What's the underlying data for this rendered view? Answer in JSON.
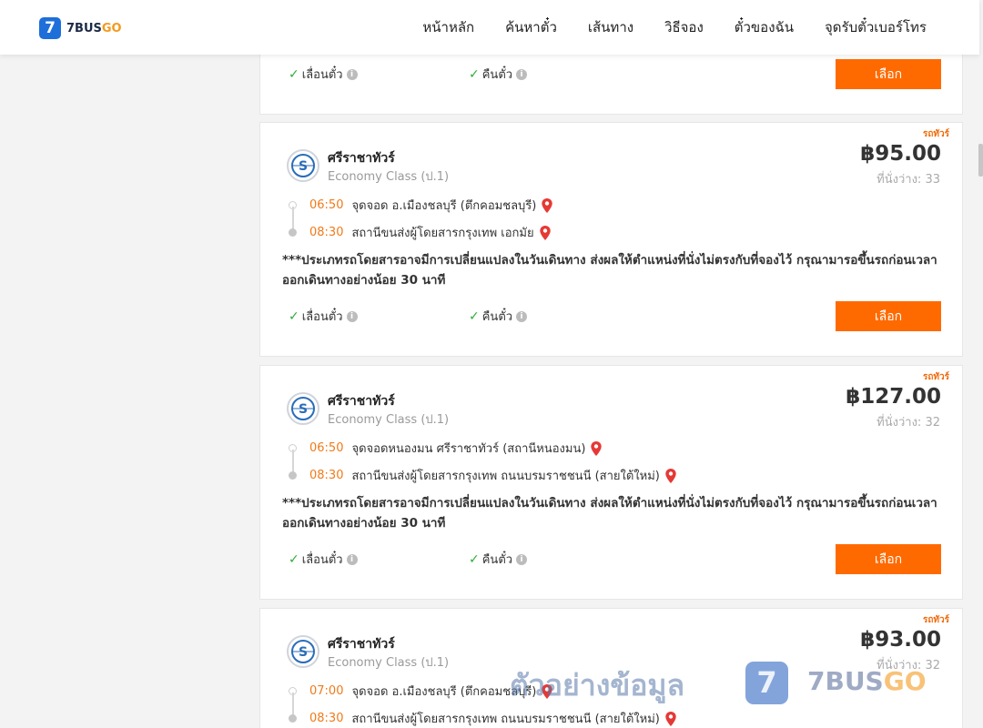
{
  "header": {
    "logo_badge": "7",
    "logo_text_main": "7BUS",
    "logo_text_accent": "GO",
    "nav": [
      "หน้าหลัก",
      "ค้นหาตั๋ว",
      "เส้นทาง",
      "วิธีจอง",
      "ตั๋วของฉัน",
      "จุดรับตั๋วเบอร์โทร"
    ]
  },
  "labels": {
    "reschedule": "เลื่อนตั๋ว",
    "refund": "คืนตั๋ว",
    "select": "เลือก",
    "ribbon": "รถทัวร์",
    "seats_prefix": "ที่นั่งว่าง:",
    "info_glyph": "i",
    "check_glyph": "✓"
  },
  "colors": {
    "accent_orange": "#ff6a00",
    "time_orange": "#f07a1a",
    "check_green": "#2eae38",
    "pin_red": "#e53935",
    "brand_blue": "#1e6fd9"
  },
  "cards": [
    {
      "operator": "ศรีราชาทัวร์",
      "bus_class": "Economy Class (ป.1)",
      "price": "฿95.00",
      "seats": "33",
      "depart_time": "06:50",
      "depart_place": "จุดจอด อ.เมืองชลบุรี (ตึกคอมชลบุรี)",
      "arrive_time": "08:30",
      "arrive_place": "สถานีขนส่งผู้โดยสารกรุงเทพ เอกมัย",
      "notice": "***ประเภทรถโดยสารอาจมีการเปลี่ยนแปลงในวันเดินทาง ส่งผลให้ตำแหน่งที่นั่งไม่ตรงกับที่จองไว้ กรุณามารอขึ้นรถก่อนเวลาออกเดินทางอย่างน้อย 30 นาที"
    },
    {
      "operator": "ศรีราชาทัวร์",
      "bus_class": "Economy Class (ป.1)",
      "price": "฿127.00",
      "seats": "32",
      "depart_time": "06:50",
      "depart_place": "จุดจอดหนองมน ศรีราชาทัวร์ (สถานีหนองมน)",
      "arrive_time": "08:30",
      "arrive_place": "สถานีขนส่งผู้โดยสารกรุงเทพ ถนนบรมราชชนนี (สายใต้ใหม่)",
      "notice": "***ประเภทรถโดยสารอาจมีการเปลี่ยนแปลงในวันเดินทาง ส่งผลให้ตำแหน่งที่นั่งไม่ตรงกับที่จองไว้ กรุณามารอขึ้นรถก่อนเวลาออกเดินทางอย่างน้อย 30 นาที"
    },
    {
      "operator": "ศรีราชาทัวร์",
      "bus_class": "Economy Class (ป.1)",
      "price": "฿93.00",
      "seats": "32",
      "depart_time": "07:00",
      "depart_place": "จุดจอด อ.เมืองชลบุรี (ตึกคอมชลบุรี)",
      "arrive_time": "08:30",
      "arrive_place": "สถานีขนส่งผู้โดยสารกรุงเทพ ถนนบรมราชชนนี (สายใต้ใหม่)"
    }
  ],
  "watermark": {
    "text": "ตัวอย่างข้อมูล",
    "badge": "7",
    "brand_main": "7BUS",
    "brand_accent": "GO"
  }
}
